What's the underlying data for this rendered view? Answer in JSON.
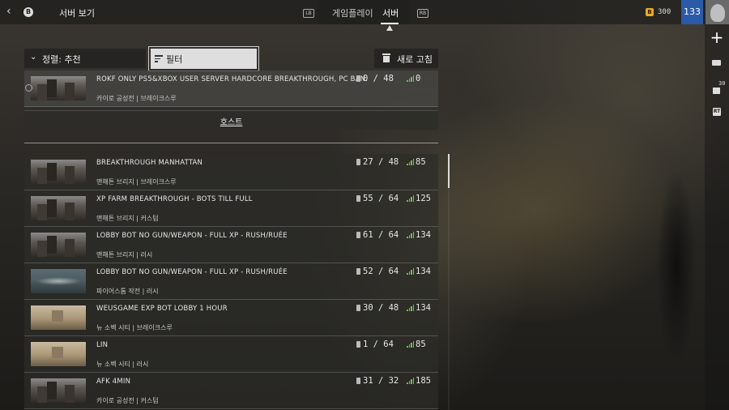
{
  "header": {
    "page_title": "서버 보기",
    "lb": "LB",
    "rb": "RB",
    "tabs": [
      {
        "label": "게임플레이",
        "active": false
      },
      {
        "label": "서버",
        "active": true
      }
    ],
    "currency_value": "300",
    "level": "133"
  },
  "rightbar": {
    "gift_count": "30",
    "rt": "RT"
  },
  "controls": {
    "sort_label": "정렬: 추천",
    "filter_label": "필터",
    "refresh_label": "새로 고침"
  },
  "hosted_server": {
    "name": "ROKF ONLY PS5&XBOX USER SERVER HARDCORE BREAKTHROUGH, PC BAN.",
    "map_mode": "카이로 공성전 | 브레이크스루",
    "players": "0 / 48",
    "ping": "0"
  },
  "host_label": "호스트",
  "servers": [
    {
      "name": "BREAKTHROUGH MANHATTAN",
      "map_mode": "맨해튼 브리지 | 브레이크스루",
      "players": "27 / 48",
      "ping": "85"
    },
    {
      "name": "XP FARM BREAKTHROUGH - BOTS TILL FULL",
      "map_mode": "맨해튼 브리지 | 커스텀",
      "players": "55 / 64",
      "ping": "125"
    },
    {
      "name": "LOBBY BOT NO GUN/WEAPON - FULL XP - RUSH/RUÉE",
      "map_mode": "맨해튼 브리지 | 러시",
      "players": "61 / 64",
      "ping": "134"
    },
    {
      "name": "LOBBY BOT NO GUN/WEAPON - FULL XP - RUSH/RUÉE",
      "map_mode": "파이어스톰 작전 | 러시",
      "players": "52 / 64",
      "ping": "134"
    },
    {
      "name": "WEUSGAME EXP BOT LOBBY 1 HOUR",
      "map_mode": "뉴 소벡 시티 | 브레이크스루",
      "players": "30 / 48",
      "ping": "134"
    },
    {
      "name": "LIN",
      "map_mode": "뉴 소벡 시티 | 러시",
      "players": "1 / 64",
      "ping": "85"
    },
    {
      "name": "AFK 4MIN",
      "map_mode": "카이로 공성전 | 커스텀",
      "players": "31 / 32",
      "ping": "185"
    }
  ],
  "colors": {
    "accent_currency": "#e8a92c",
    "level_badge": "#2a5aa8",
    "ping_good": "#6cc24a"
  }
}
